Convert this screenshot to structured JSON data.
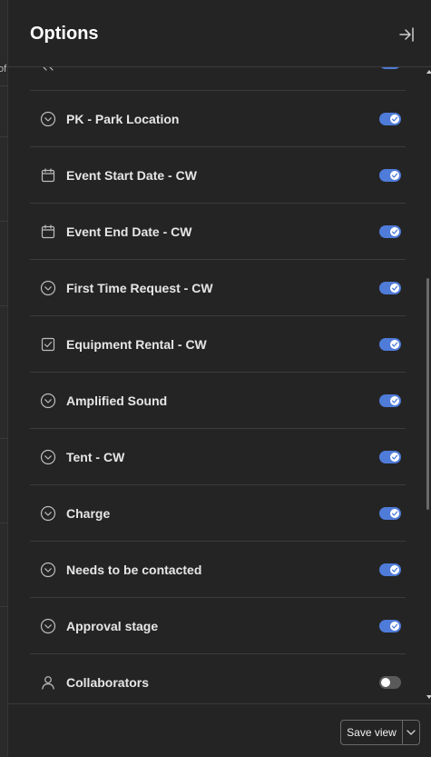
{
  "panel": {
    "title": "Options",
    "collapse_icon": "collapse-right-icon"
  },
  "backdrop": {
    "glyph": "of"
  },
  "fields": [
    {
      "label": "",
      "icon": "partial-icon",
      "enabled": true
    },
    {
      "label": "PK - Park Location",
      "icon": "chevron-circle-icon",
      "enabled": true
    },
    {
      "label": "Event Start Date - CW",
      "icon": "calendar-icon",
      "enabled": true
    },
    {
      "label": "Event End Date - CW",
      "icon": "calendar-icon",
      "enabled": true
    },
    {
      "label": "First Time Request - CW",
      "icon": "chevron-circle-icon",
      "enabled": true
    },
    {
      "label": "Equipment Rental - CW",
      "icon": "checkbox-icon",
      "enabled": true
    },
    {
      "label": "Amplified Sound",
      "icon": "chevron-circle-icon",
      "enabled": true
    },
    {
      "label": "Tent - CW",
      "icon": "chevron-circle-icon",
      "enabled": true
    },
    {
      "label": "Charge",
      "icon": "chevron-circle-icon",
      "enabled": true
    },
    {
      "label": "Needs to be contacted",
      "icon": "chevron-circle-icon",
      "enabled": true
    },
    {
      "label": "Approval stage",
      "icon": "chevron-circle-icon",
      "enabled": true
    },
    {
      "label": "Collaborators",
      "icon": "person-icon",
      "enabled": false
    }
  ],
  "footer": {
    "save_label": "Save view",
    "dropdown_icon": "chevron-down-icon"
  },
  "colors": {
    "accent": "#4f7bd9",
    "toggle_off": "#5a5a5a",
    "panel_bg": "#242424"
  }
}
